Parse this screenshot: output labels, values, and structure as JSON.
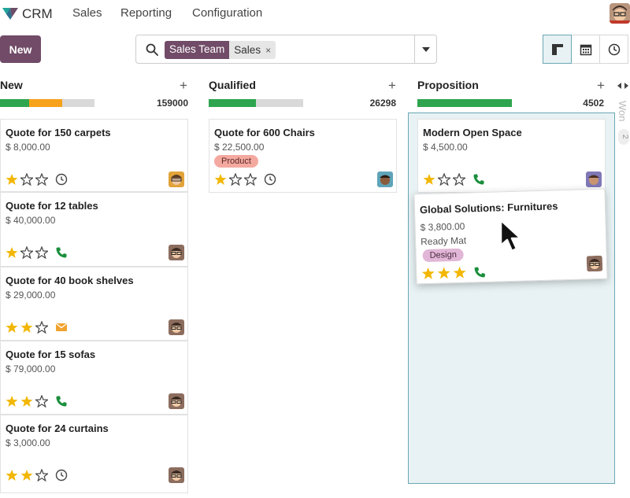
{
  "app": {
    "name": "CRM"
  },
  "nav": {
    "sales": "Sales",
    "reporting": "Reporting",
    "configuration": "Configuration"
  },
  "toolbar": {
    "new_label": "New"
  },
  "search": {
    "facet_key": "Sales Team",
    "facet_value": "Sales",
    "placeholder": "",
    "remove_symbol": "×"
  },
  "views": [
    "kanban-icon",
    "calendar-icon",
    "activity-clock-icon"
  ],
  "colors": {
    "brand": "#714b67",
    "progress_green": "#2ea44f",
    "progress_orange": "#f7a21b",
    "progress_grey": "#d9d9d9",
    "star": "#f2b705",
    "phone": "#1a8e3c",
    "mail": "#f0a22e",
    "drop_zone": "#e8f2f4",
    "tag_product": "#f4a9a0",
    "tag_design": "#e1b6d6"
  },
  "columns": [
    {
      "title": "New",
      "total": "159000",
      "progress": {
        "green": 0.31,
        "orange": 0.35,
        "grey": 0.34
      },
      "cards": [
        {
          "title": "Quote for 150 carpets",
          "amount": "$ 8,000.00",
          "stars": 1,
          "activity": "clock-icon"
        },
        {
          "title": "Quote for 12 tables",
          "amount": "$ 40,000.00",
          "stars": 1,
          "activity": "phone-icon"
        },
        {
          "title": "Quote for 40 book shelves",
          "amount": "$ 29,000.00",
          "stars": 2,
          "activity": "envelope-icon"
        },
        {
          "title": "Quote for 15 sofas",
          "amount": "$ 79,000.00",
          "stars": 2,
          "activity": "phone-icon"
        },
        {
          "title": "Quote for 24 curtains",
          "amount": "$ 3,000.00",
          "stars": 2,
          "activity": "clock-icon"
        }
      ]
    },
    {
      "title": "Qualified",
      "total": "26298",
      "progress": {
        "green": 0.5,
        "orange": 0,
        "grey": 0.5
      },
      "cards": [
        {
          "title": "Quote for 600 Chairs",
          "amount": "$ 22,500.00",
          "tag": "Product",
          "stars": 1,
          "activity": "clock-icon"
        }
      ]
    },
    {
      "title": "Proposition",
      "total": "4502",
      "progress": {
        "green": 1,
        "orange": 0,
        "grey": 0
      },
      "cards": [
        {
          "title": "Modern Open Space",
          "amount": "$ 4,500.00",
          "stars": 1,
          "activity": "phone-icon"
        }
      ],
      "dragged_card": {
        "title": "Global Solutions: Furnitures",
        "amount": "$ 3,800.00",
        "customer": "Ready Mat",
        "tag": "Design",
        "stars": 3,
        "activity": "phone-icon"
      }
    }
  ],
  "folded_column": {
    "title": "Won",
    "count": "2"
  }
}
